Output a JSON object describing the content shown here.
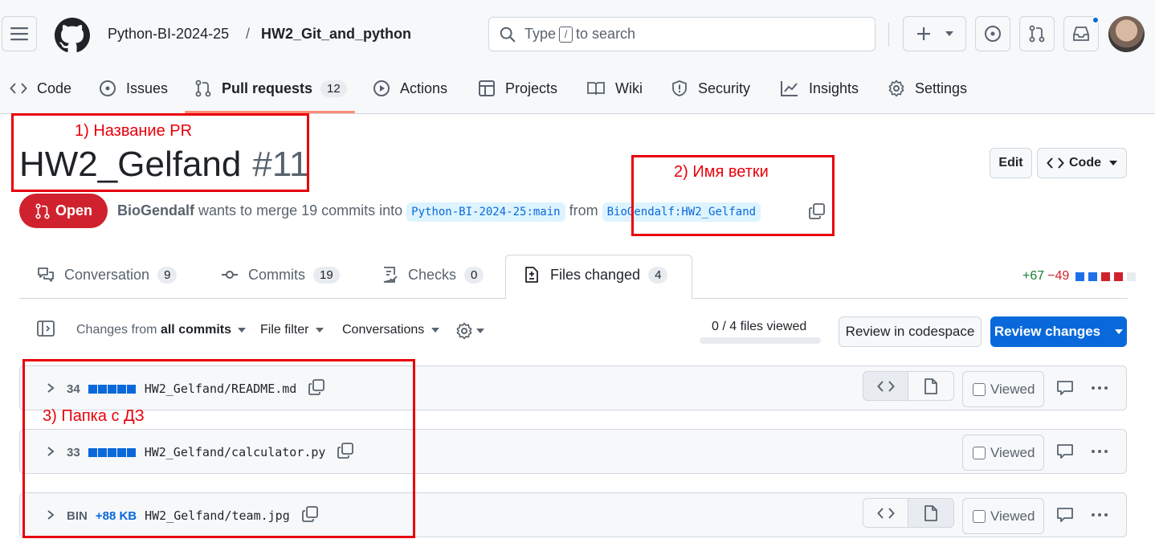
{
  "header": {
    "owner": "Python-BI-2024-25",
    "separator": "/",
    "repo": "HW2_Git_and_python",
    "search": {
      "prefix": "Type",
      "key": "/",
      "suffix": "to search"
    }
  },
  "repo_nav": [
    {
      "label": "Code",
      "icon": "code-icon"
    },
    {
      "label": "Issues",
      "icon": "issue-icon"
    },
    {
      "label": "Pull requests",
      "icon": "pull-request-icon",
      "count": "12",
      "active": true
    },
    {
      "label": "Actions",
      "icon": "play-icon"
    },
    {
      "label": "Projects",
      "icon": "table-icon"
    },
    {
      "label": "Wiki",
      "icon": "book-icon"
    },
    {
      "label": "Security",
      "icon": "shield-icon"
    },
    {
      "label": "Insights",
      "icon": "graph-icon"
    },
    {
      "label": "Settings",
      "icon": "gear-icon"
    }
  ],
  "pr": {
    "title": "HW2_Gelfand",
    "number": "#11",
    "state": "Open",
    "author": "BioGendalf",
    "action_text": "wants to merge 19 commits into",
    "base_branch": "Python-BI-2024-25:main",
    "from_word": "from",
    "head_branch": "BioGendalf:HW2_Gelfand",
    "edit_label": "Edit",
    "code_label": "Code"
  },
  "tabs": [
    {
      "label": "Conversation",
      "count": "9",
      "icon": "comment-discussion-icon"
    },
    {
      "label": "Commits",
      "count": "19",
      "icon": "commit-icon"
    },
    {
      "label": "Checks",
      "count": "0",
      "icon": "checklist-icon"
    },
    {
      "label": "Files changed",
      "count": "4",
      "icon": "file-diff-icon",
      "active": true
    }
  ],
  "diffstat": {
    "additions": "+67",
    "deletions": "−49",
    "add_color": "#1a7f37",
    "del_color": "#cf222e"
  },
  "toolbar": {
    "changes_from_prefix": "Changes from",
    "changes_from_value": "all commits",
    "file_filter": "File filter",
    "conversations": "Conversations",
    "files_viewed": "0 / 4 files viewed",
    "files_viewed_fraction": 0,
    "review_codespace": "Review in codespace",
    "review_changes": "Review changes"
  },
  "files": [
    {
      "changes": "34",
      "path": "HW2_Gelfand/README.md",
      "viewed_label": "Viewed",
      "display_toggle": true,
      "binary": false
    },
    {
      "changes": "33",
      "path": "HW2_Gelfand/calculator.py",
      "viewed_label": "Viewed",
      "display_toggle": false,
      "binary": false
    },
    {
      "changes": "BIN",
      "size_delta": "+88 KB",
      "path": "HW2_Gelfand/team.jpg",
      "viewed_label": "Viewed",
      "display_toggle": true,
      "binary": true
    }
  ],
  "annotations": {
    "pr_name": "1) Название PR",
    "branch_name": "2) Имя ветки",
    "hw_folder": "3) Папка с ДЗ"
  },
  "colors": {
    "accent": "#0969da",
    "danger": "#cf222e",
    "success": "#1a7f37",
    "annotation": "#e8000b",
    "nav_underline": "#fd8c73"
  }
}
